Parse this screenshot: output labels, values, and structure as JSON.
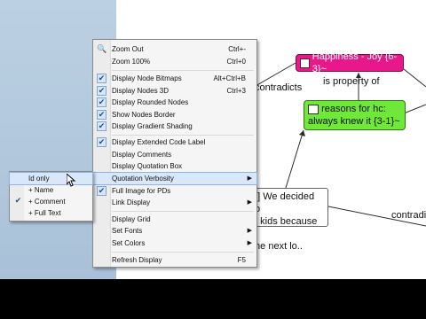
{
  "nodes": {
    "happiness": "Happiness - Joy {6-3}~",
    "reasons": "reasons for hc: always knew it {3-1}~",
    "quote_line1": "9] We decided to",
    "quote_line2": "e kids because it",
    "quote_line3": "the next lo.."
  },
  "edge_labels": {
    "contradicts_1": "contradicts",
    "is_property_of": "is property of",
    "contradicts_2": "contradi"
  },
  "menu": {
    "zoom_out": {
      "label": "Zoom Out",
      "shortcut": "Ctrl+-"
    },
    "zoom_100": {
      "label": "Zoom 100%",
      "shortcut": "Ctrl+0"
    },
    "bitmaps": {
      "label": "Display Node Bitmaps",
      "shortcut": "Alt+Ctrl+B",
      "checked": true
    },
    "nodes3d": {
      "label": "Display Nodes 3D",
      "shortcut": "Ctrl+3",
      "checked": true
    },
    "rounded": {
      "label": "Display Rounded Nodes",
      "checked": true
    },
    "border": {
      "label": "Show Nodes Border",
      "checked": true
    },
    "gradient": {
      "label": "Display Gradient Shading",
      "checked": true
    },
    "extended": {
      "label": "Display Extended Code Label",
      "checked": true
    },
    "comments": {
      "label": "Display Comments"
    },
    "quotation_box": {
      "label": "Display Quotation Box"
    },
    "verbosity": {
      "label": "Quotation Verbosity"
    },
    "full_image": {
      "label": "Full Image for PDs",
      "checked": true
    },
    "link_display": {
      "label": "Link Display"
    },
    "grid": {
      "label": "Display Grid"
    },
    "fonts": {
      "label": "Set Fonts"
    },
    "colors": {
      "label": "Set Colors"
    },
    "refresh": {
      "label": "Refresh Display",
      "shortcut": "F5"
    }
  },
  "submenu": {
    "id_only": "Id only",
    "name": "+ Name",
    "comment": "+ Comment",
    "full_text": "+ Full Text"
  },
  "colors": {
    "happiness_node": "#e8178a",
    "reasons_node": "#6fe83a",
    "menu_highlight": "#d8e8fa"
  }
}
